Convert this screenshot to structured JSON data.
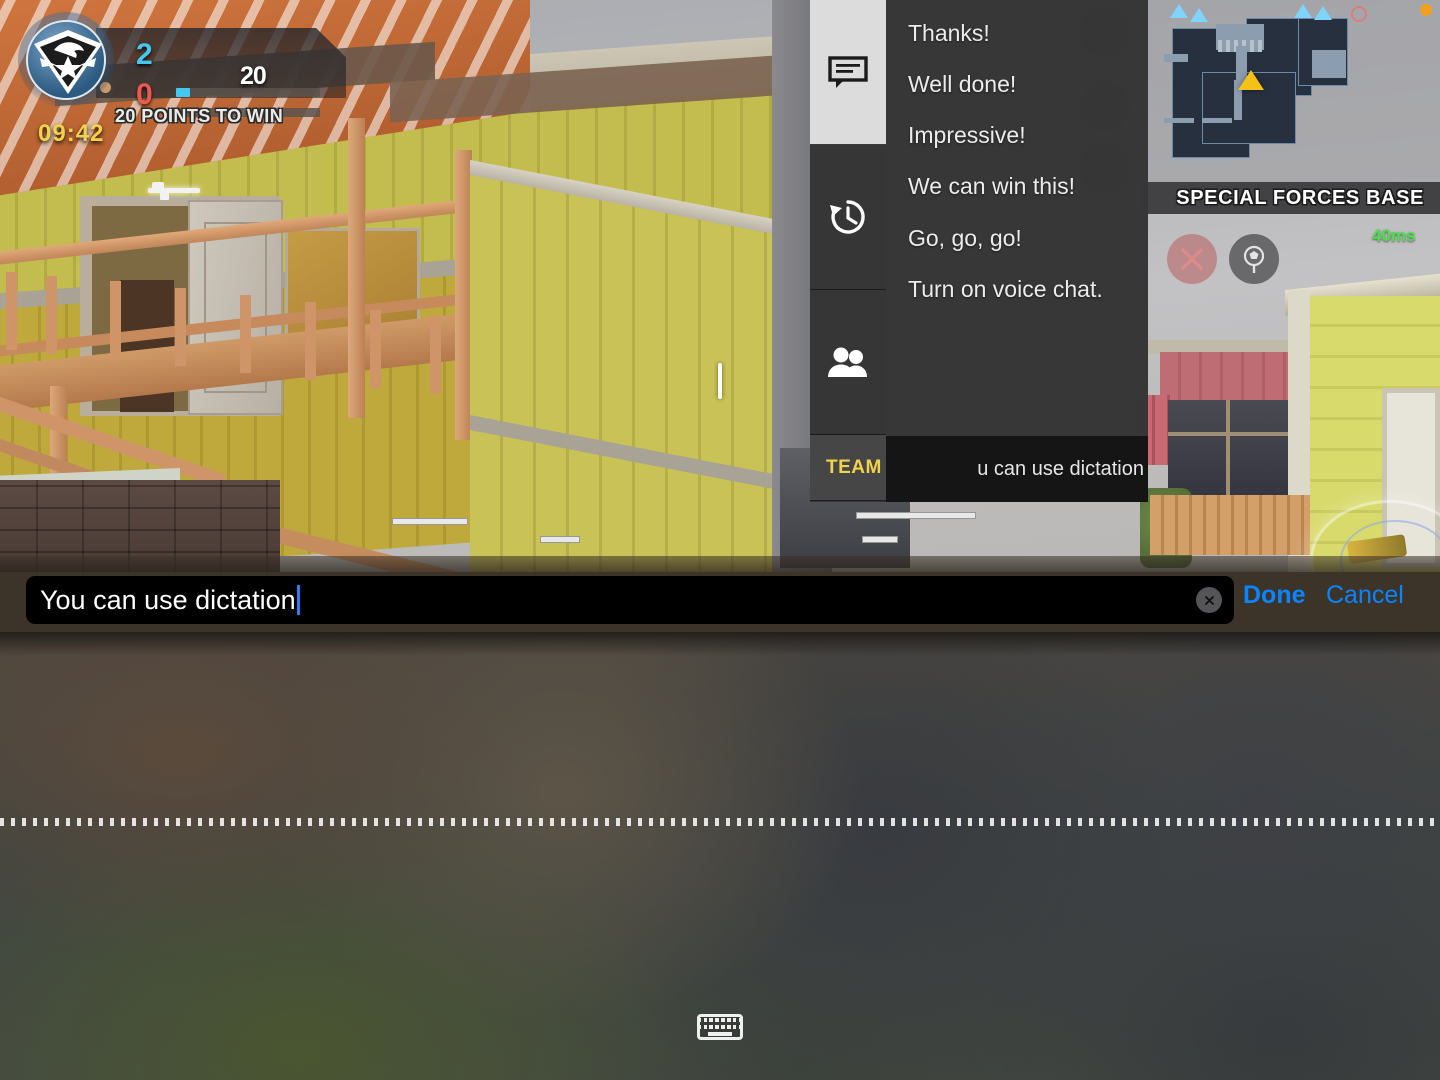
{
  "hud": {
    "timer": "09:42",
    "score_blue": "2",
    "score_red": "0",
    "score_target": "20",
    "points_to_win": "20 POINTS TO WIN",
    "badge_icon": "eagle-emblem-icon",
    "progress_percent": 10,
    "colors": {
      "blue_team": "#45c8f0",
      "red_team": "#f0574f",
      "timer": "#f2d24b",
      "ping": "#4ce04c"
    }
  },
  "minimap": {
    "location_name": "SPECIAL FORCES BASE",
    "ping": "40ms",
    "player_marker_icon": "player-arrow-icon",
    "ally_marker_icon": "ally-arrow-icon",
    "enemy_marker_icon": "enemy-circle-icon"
  },
  "right_buttons": [
    {
      "name": "settings",
      "icon": "gear-icon",
      "label": ""
    },
    {
      "name": "team-voice",
      "icon": "speaker-icon",
      "label": "TEAM"
    },
    {
      "name": "microphone",
      "icon": "mic-muted-icon",
      "label": ""
    }
  ],
  "action_buttons": [
    {
      "name": "cancel-action",
      "icon": "x-cross-icon"
    },
    {
      "name": "spot-marker",
      "icon": "spot-pin-icon"
    }
  ],
  "chat_panel": {
    "tabs": [
      {
        "id": "quick-messages",
        "icon": "chat-bubble-icon",
        "active": true
      },
      {
        "id": "history",
        "icon": "history-clock-icon",
        "active": false
      },
      {
        "id": "team",
        "icon": "people-icon",
        "active": false
      }
    ],
    "channel_label": "TEAM",
    "messages": [
      "Thanks!",
      "Well done!",
      "Impressive!",
      "We can win this!",
      "Go, go, go!",
      "Turn on voice chat."
    ],
    "preview_text": "u can use dictation"
  },
  "input_bar": {
    "value": "You can use dictation",
    "placeholder": "",
    "clear_icon": "clear-circle-x-icon",
    "done_label": "Done",
    "cancel_label": "Cancel",
    "accent_color": "#0a84ff",
    "caret_color": "#2f7cf6"
  },
  "keyboard": {
    "dismiss_icon": "keyboard-dismiss-icon"
  },
  "scene": {
    "crosshair_icon": "crosshair-icon",
    "weapon_pickup_icon": "weapon-pickup-icon",
    "nametags": [
      "",
      ""
    ]
  }
}
